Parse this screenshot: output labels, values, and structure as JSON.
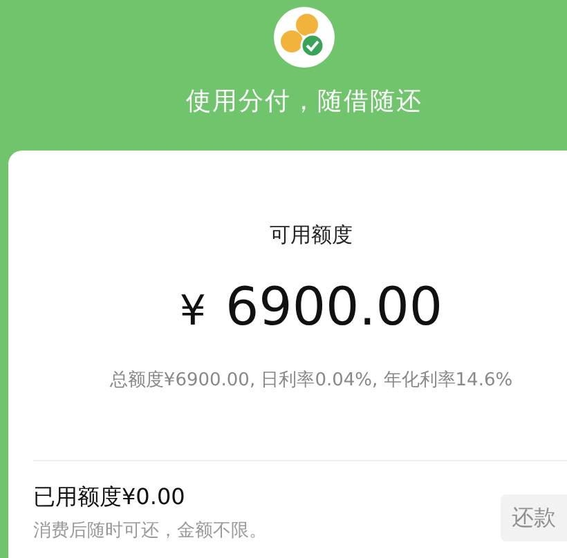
{
  "header": {
    "slogan": "使用分付，随借随还"
  },
  "available": {
    "label": "可用额度",
    "currency": "¥",
    "amount": "6900.00",
    "rates": "总额度¥6900.00, 日利率0.04%, 年化利率14.6%"
  },
  "used": {
    "label": "已用额度¥0.00",
    "note": "消费后随时可还，金额不限。",
    "repay_button": {
      "label": "还款",
      "disabled": true
    }
  }
}
